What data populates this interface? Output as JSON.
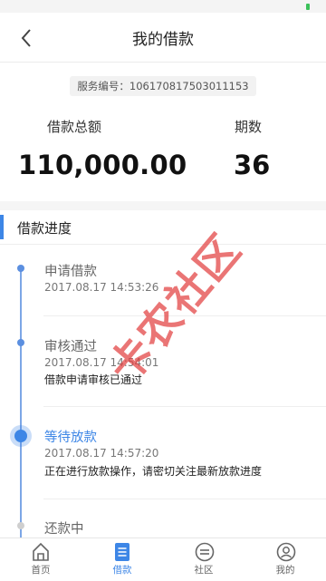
{
  "header": {
    "title": "我的借款"
  },
  "service": {
    "label": "服务编号：",
    "number": "106170817503011153"
  },
  "summary": {
    "total_label": "借款总额",
    "total_value": "110,000.00",
    "period_label": "期数",
    "period_value": "36"
  },
  "section": {
    "title": "借款进度"
  },
  "progress": [
    {
      "title": "申请借款",
      "time": "2017.08.17 14:53:26",
      "desc": ""
    },
    {
      "title": "审核通过",
      "time": "2017.08.17 14:54:01",
      "desc": "借款申请审核已通过"
    },
    {
      "title": "等待放款",
      "time": "2017.08.17 14:57:20",
      "desc": "正在进行放款操作，请密切关注最新放款进度"
    },
    {
      "title": "还款中",
      "time": "",
      "desc": ""
    }
  ],
  "tabs": [
    {
      "label": "首页",
      "icon": "home-icon"
    },
    {
      "label": "借款",
      "icon": "document-icon",
      "active": true
    },
    {
      "label": "社区",
      "icon": "community-icon"
    },
    {
      "label": "我的",
      "icon": "profile-icon"
    }
  ],
  "watermark": {
    "text": "卡农社区"
  },
  "colors": {
    "accent": "#3d86e6",
    "watermark": "#e24040"
  }
}
